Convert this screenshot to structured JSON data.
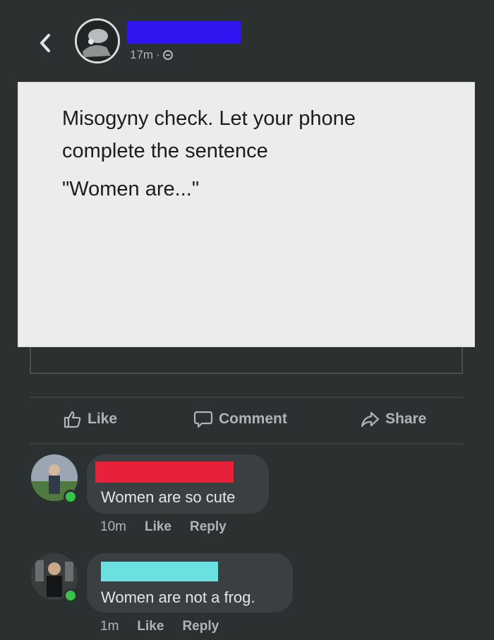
{
  "header": {
    "back_icon": "chevron-left-icon",
    "time": "17m",
    "separator": "·",
    "audience_icon": "globe-icon",
    "name_redaction_color": "#3015f0"
  },
  "post": {
    "lines": [
      "Misogyny check. Let your phone",
      "complete the sentence"
    ],
    "quote": "\"Women are...\""
  },
  "actions": {
    "like": "Like",
    "comment": "Comment",
    "share": "Share"
  },
  "comments": [
    {
      "redaction_color": "#e8213a",
      "text": "Women are so cute",
      "time": "10m",
      "like": "Like",
      "reply": "Reply",
      "online": true
    },
    {
      "redaction_color": "#6be0e0",
      "text": "Women are not a frog.",
      "time": "1m",
      "like": "Like",
      "reply": "Reply",
      "online": true
    }
  ]
}
